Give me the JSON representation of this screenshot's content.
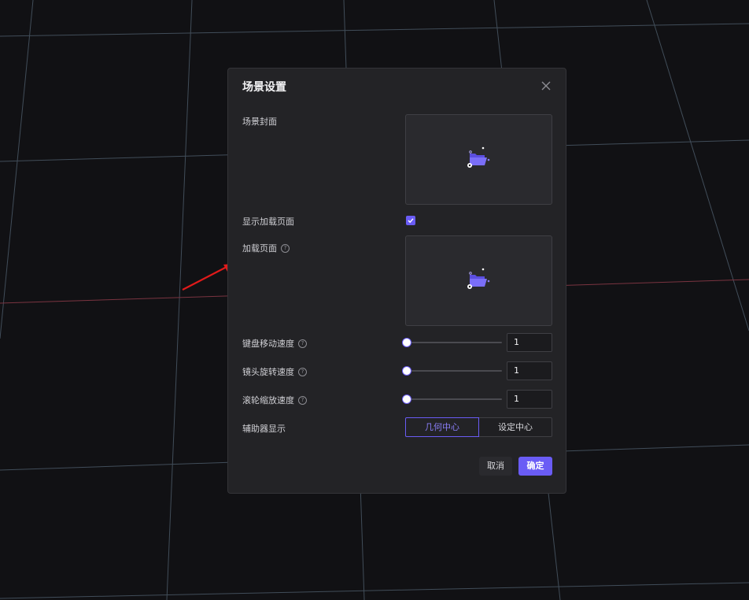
{
  "dialog": {
    "title": "场景设置",
    "close_icon": "close-icon"
  },
  "form": {
    "scene_cover_label": "场景封面",
    "show_loading_label": "显示加载页面",
    "show_loading_checked": true,
    "loading_page_label": "加载页面",
    "keyboard_speed_label": "键盘移动速度",
    "keyboard_speed_value": "1",
    "camera_rotate_label": "镜头旋转速度",
    "camera_rotate_value": "1",
    "wheel_zoom_label": "滚轮缩放速度",
    "wheel_zoom_value": "1",
    "helper_display_label": "辅助器显示",
    "helper_options": [
      "几何中心",
      "设定中心"
    ],
    "helper_selected": "几何中心",
    "help_glyph": "?"
  },
  "footer": {
    "cancel_label": "取消",
    "ok_label": "确定"
  },
  "colors": {
    "accent": "#6a5cf5",
    "background": "#111114",
    "dialog": "#232326",
    "annotation_arrow": "#e01a1a"
  }
}
